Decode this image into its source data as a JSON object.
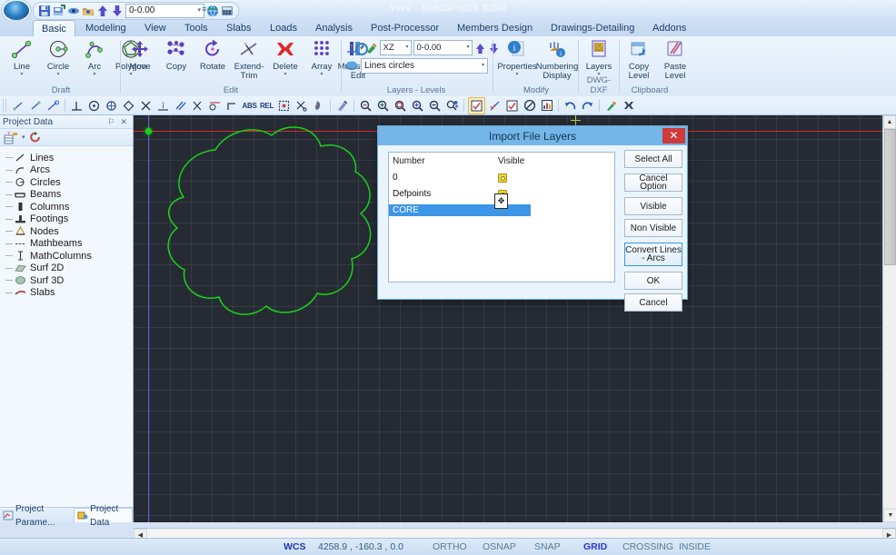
{
  "window": {
    "title": "vvvv - ScadaPro15 32Bit",
    "quick_access": [
      {
        "name": "save-icon",
        "label": "Save"
      },
      {
        "name": "save-as-icon",
        "label": "Save As"
      },
      {
        "name": "view-icon",
        "label": "View"
      },
      {
        "name": "open-icon",
        "label": "Open"
      },
      {
        "name": "level-up-icon",
        "label": "Level Up"
      },
      {
        "name": "level-down-icon",
        "label": "Level Down"
      },
      {
        "name": "globe-icon",
        "label": "Globe"
      },
      {
        "name": "calculator-icon",
        "label": "Calculator"
      }
    ],
    "quick_access_value": "0-0.00",
    "customize_glyph": "≡"
  },
  "tabs": [
    {
      "label": "Basic",
      "active": true
    },
    {
      "label": "Modeling",
      "active": false
    },
    {
      "label": "View",
      "active": false
    },
    {
      "label": "Tools",
      "active": false
    },
    {
      "label": "Slabs",
      "active": false
    },
    {
      "label": "Loads",
      "active": false
    },
    {
      "label": "Analysis",
      "active": false
    },
    {
      "label": "Post-Processor",
      "active": false
    },
    {
      "label": "Members Design",
      "active": false
    },
    {
      "label": "Drawings-Detailing",
      "active": false
    },
    {
      "label": "Addons",
      "active": false
    }
  ],
  "ribbon": {
    "groups": [
      {
        "label": "Draft",
        "items": [
          {
            "label": "Line",
            "icon": "line-icon",
            "dropdown": true
          },
          {
            "label": "Circle",
            "icon": "circle-icon",
            "dropdown": true
          },
          {
            "label": "Arc",
            "icon": "arc-icon",
            "dropdown": true
          },
          {
            "label": "Polygon",
            "icon": "polygon-icon",
            "dropdown": true
          }
        ]
      },
      {
        "label": "Edit",
        "items": [
          {
            "label": "Move",
            "icon": "move-icon",
            "dropdown": false
          },
          {
            "label": "Copy",
            "icon": "copy-icon",
            "dropdown": false
          },
          {
            "label": "Rotate",
            "icon": "rotate-icon",
            "dropdown": false
          },
          {
            "label": "Extend-Trim",
            "icon": "extend-trim-icon",
            "dropdown": false
          },
          {
            "label": "Delete",
            "icon": "delete-icon",
            "dropdown": true
          },
          {
            "label": "Array",
            "icon": "array-icon",
            "dropdown": true
          },
          {
            "label": "Multiselect Edit",
            "icon": "multiselect-edit-icon",
            "dropdown": false
          }
        ]
      },
      {
        "label": "Layers - Levels",
        "plane_value": "XZ",
        "level_value": "0-0.00",
        "layer_value": "Lines circles",
        "icons": [
          {
            "name": "level-tool-icon"
          },
          {
            "name": "paint-layer-icon"
          },
          {
            "name": "move-up-icon"
          },
          {
            "name": "move-down-icon"
          },
          {
            "name": "layer-combo-icon"
          }
        ]
      },
      {
        "label": "Modify",
        "items": [
          {
            "label": "Properties",
            "icon": "properties-icon",
            "dropdown": true
          },
          {
            "label": "Numbering Display",
            "icon": "numbering-display-icon",
            "dropdown": false
          }
        ]
      },
      {
        "label": "DWG-DXF",
        "items": [
          {
            "label": "Layers",
            "icon": "dxf-layers-icon",
            "dropdown": true
          }
        ]
      },
      {
        "label": "Clipboard",
        "items": [
          {
            "label": "Copy Level",
            "icon": "copy-level-icon",
            "dropdown": false
          },
          {
            "label": "Paste Level",
            "icon": "paste-level-icon",
            "dropdown": false
          }
        ]
      }
    ]
  },
  "toolbar2": {
    "groups": [
      [
        "point-line-icon",
        "line-segment-icon",
        "line-measure-icon"
      ],
      [
        "perpendicular-icon",
        "center-snap-icon",
        "node-snap-icon",
        "quadrant-snap-icon",
        "intersection-snap-icon",
        "midpoint-snap-icon",
        "parallel-snap-icon",
        "nearest-snap-icon",
        "tangent-snap-icon",
        "extension-snap-icon"
      ],
      [
        "abs-coords-button",
        "rel-coords-button",
        "select-window-icon",
        "deselect-icon",
        "pick-icon"
      ],
      [
        "pen-icon"
      ],
      [
        "zoom-out-icon",
        "zoom-in-icon",
        "zoom-window-icon",
        "zoom-extents-icon",
        "zoom-previous-icon",
        "zoom-dynamic-icon"
      ],
      [
        "check-red-icon",
        "check-diagonal-icon",
        "check-box-icon",
        "forbidden-icon",
        "chart-icon"
      ],
      [
        "undo-icon",
        "redo-icon"
      ],
      [
        "brush-icon",
        "clear-icon"
      ]
    ],
    "abs_label": "ABS",
    "rel_label": "REL"
  },
  "left_panel": {
    "title": "Project Data",
    "pin_glyph": "⚐",
    "close_glyph": "✕",
    "toolbar_icons": [
      {
        "name": "tree-filter-icon"
      },
      {
        "name": "chevron-down-icon",
        "glyph": "▾"
      },
      {
        "name": "refresh-icon"
      }
    ],
    "tree_items": [
      {
        "label": "Lines",
        "icon": "lines-icon"
      },
      {
        "label": "Arcs",
        "icon": "arcs-icon"
      },
      {
        "label": "Circles",
        "icon": "circles-icon"
      },
      {
        "label": "Beams",
        "icon": "beams-icon"
      },
      {
        "label": "Columns",
        "icon": "columns-icon"
      },
      {
        "label": "Footings",
        "icon": "footings-icon"
      },
      {
        "label": "Nodes",
        "icon": "nodes-icon"
      },
      {
        "label": "Mathbeams",
        "icon": "mathbeams-icon"
      },
      {
        "label": "MathColumns",
        "icon": "mathcolumns-icon"
      },
      {
        "label": "Surf 2D",
        "icon": "surf2d-icon"
      },
      {
        "label": "Surf 3D",
        "icon": "surf3d-icon"
      },
      {
        "label": "Slabs",
        "icon": "slabs-icon"
      }
    ],
    "bottom_tabs": [
      {
        "label": "Project Parame...",
        "icon": "project-parameters-icon",
        "active": false
      },
      {
        "label": "Project Data",
        "icon": "project-data-icon",
        "active": true
      }
    ]
  },
  "canvas": {
    "background_color": "#262b33",
    "grid_color": "#7a8ca5",
    "x_axis_color": "#d22b2b",
    "y_axis_color": "#5a5ad8",
    "shape_color": "#18d318",
    "origin_marker": "origin-point"
  },
  "dialog": {
    "title": "Import File Layers",
    "close_glyph": "✕",
    "list": {
      "columns": [
        "Number",
        "Visible"
      ],
      "rows": [
        {
          "number": "0",
          "visible": true,
          "selected": false
        },
        {
          "number": "Defpoints",
          "visible": true,
          "selected": false
        },
        {
          "number": "CORE",
          "visible": true,
          "selected": true
        }
      ]
    },
    "buttons": [
      {
        "label": "Select All",
        "name": "select-all-button",
        "focus": false,
        "tall": false,
        "gap": false
      },
      {
        "label": "Cancel Option",
        "name": "cancel-option-button",
        "focus": false,
        "tall": false,
        "gap": true
      },
      {
        "label": "Visible",
        "name": "visible-button",
        "focus": false,
        "tall": false,
        "gap": true
      },
      {
        "label": "Non Visible",
        "name": "non-visible-button",
        "focus": false,
        "tall": false,
        "gap": false
      },
      {
        "label": "Convert Lines - Arcs",
        "name": "convert-lines-arcs-button",
        "focus": true,
        "tall": true,
        "gap": true
      },
      {
        "label": "OK",
        "name": "ok-button",
        "focus": false,
        "tall": false,
        "gap": true
      },
      {
        "label": "Cancel",
        "name": "cancel-button",
        "focus": false,
        "tall": false,
        "gap": false
      }
    ],
    "cursor_glyph": "✥"
  },
  "status_bar": {
    "wcs_label": "WCS",
    "coordinates": "4258.9 , -160.3 , 0.0",
    "toggles": [
      {
        "label": "ORTHO",
        "active": false
      },
      {
        "label": "OSNAP",
        "active": false
      },
      {
        "label": "SNAP",
        "active": false
      },
      {
        "label": "GRID",
        "active": true
      },
      {
        "label": "CROSSING",
        "active": false
      },
      {
        "label": "INSIDE",
        "active": false
      }
    ]
  }
}
